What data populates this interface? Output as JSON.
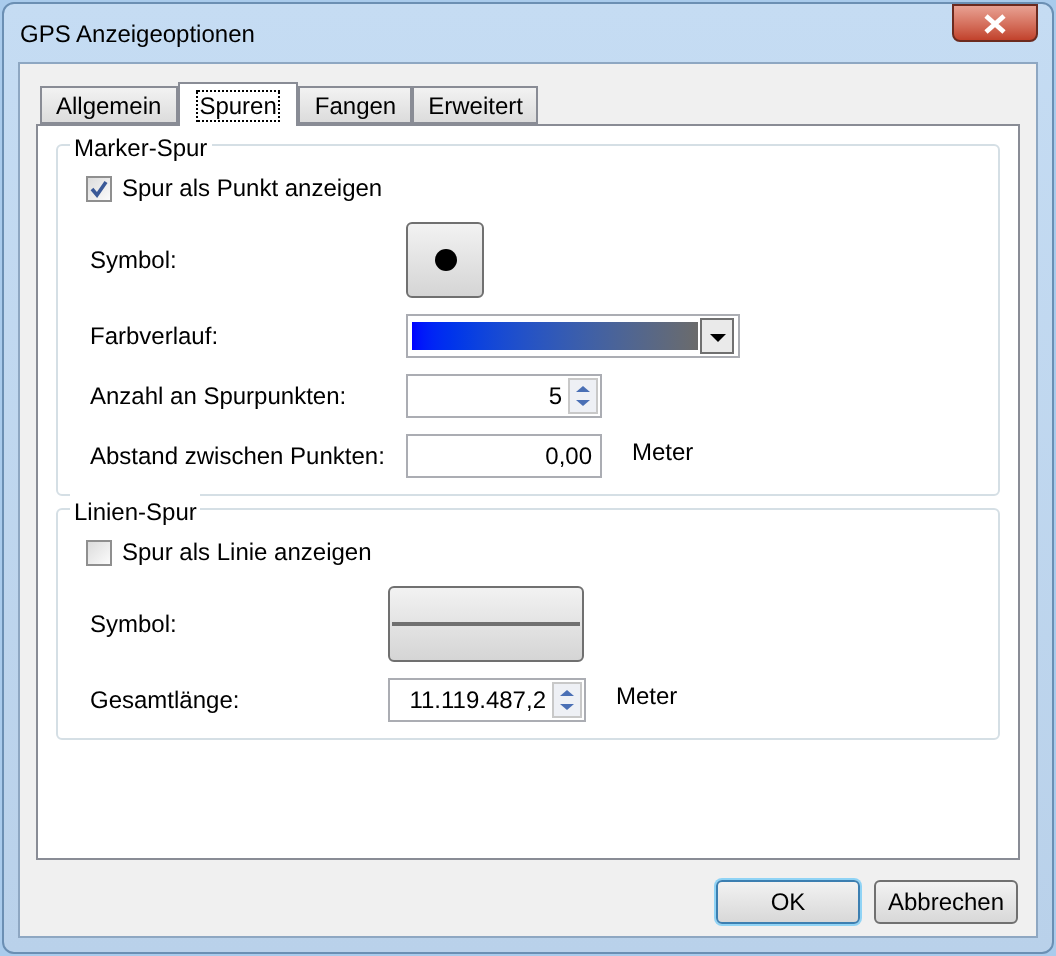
{
  "window": {
    "title": "GPS Anzeigeoptionen"
  },
  "tabs": [
    {
      "label": "Allgemein",
      "selected": false
    },
    {
      "label": "Spuren",
      "selected": true
    },
    {
      "label": "Fangen",
      "selected": false
    },
    {
      "label": "Erweitert",
      "selected": false
    }
  ],
  "groups": [
    {
      "title": "Marker-Spur",
      "checkbox": {
        "label": "Spur als Punkt anzeigen",
        "checked": true
      },
      "fields": [
        {
          "kind": "dot-symbol",
          "label": "Symbol:"
        },
        {
          "kind": "gradient",
          "label": "Farbverlauf:"
        },
        {
          "kind": "spinner",
          "label": "Anzahl an Spurpunkten:",
          "value": "5"
        },
        {
          "kind": "text",
          "label": "Abstand zwischen Punkten:",
          "value": "0,00",
          "unit": "Meter"
        }
      ]
    },
    {
      "title": "Linien-Spur",
      "checkbox": {
        "label": "Spur als Linie anzeigen",
        "checked": false
      },
      "fields": [
        {
          "kind": "line-symbol",
          "label": "Symbol:"
        },
        {
          "kind": "spinner",
          "label": "Gesamtlänge:",
          "value": "11.119.487,2",
          "unit": "Meter"
        }
      ]
    }
  ],
  "buttons": [
    {
      "label": "OK",
      "default": true
    },
    {
      "label": "Abbrechen",
      "default": false
    }
  ]
}
